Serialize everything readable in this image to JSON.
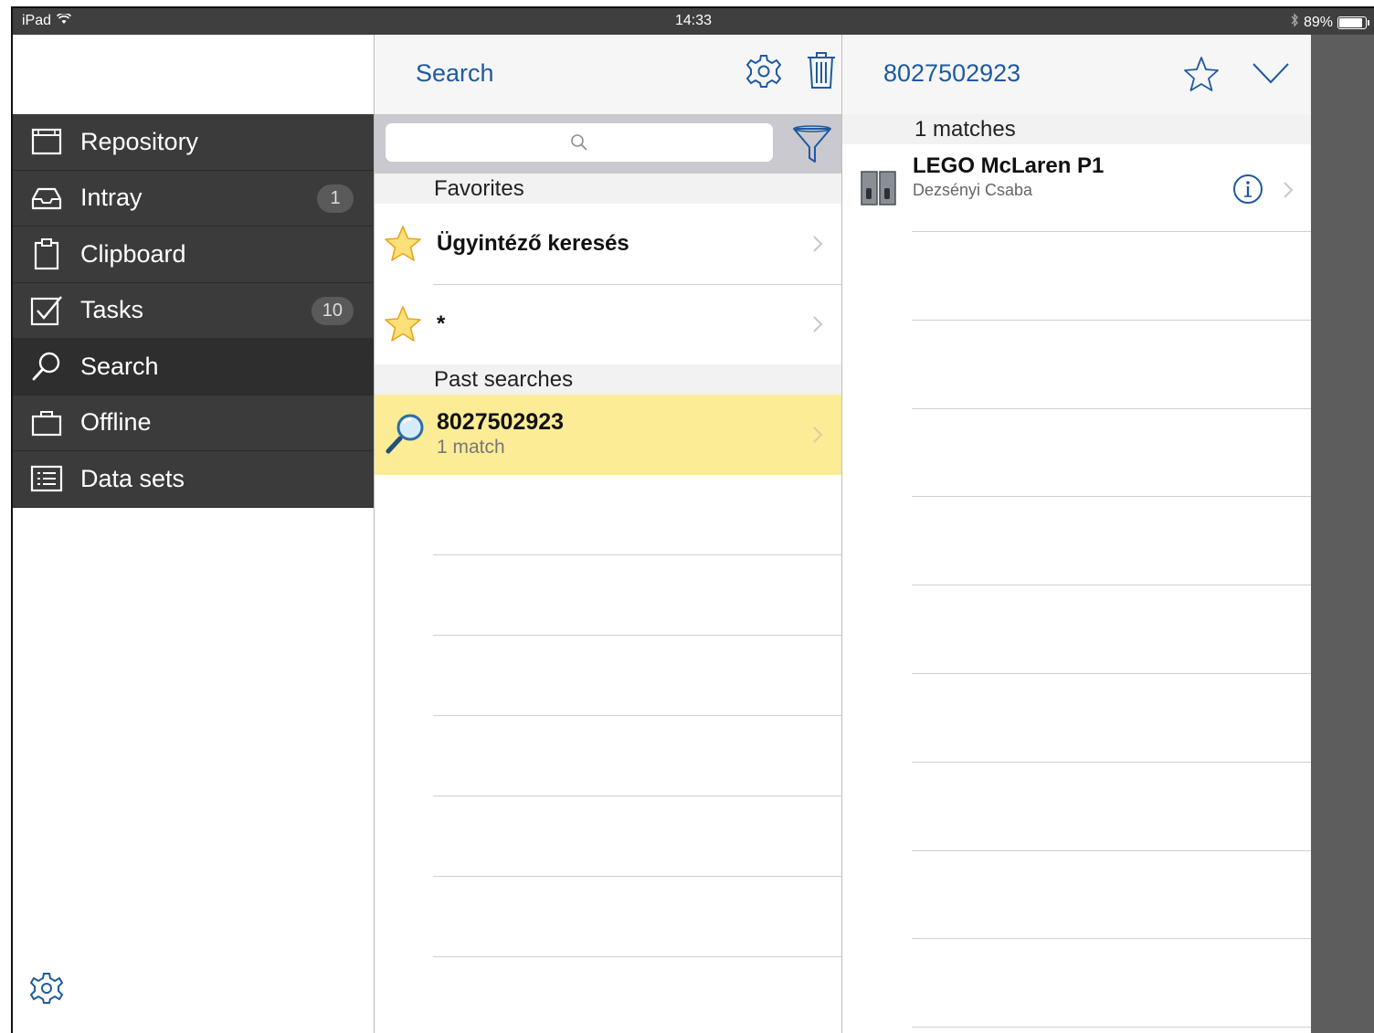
{
  "status_bar": {
    "device": "iPad",
    "time": "14:33",
    "battery_percent": "89%",
    "battery_level": 0.89
  },
  "sidebar": {
    "items": [
      {
        "label": "Repository",
        "icon": "window-icon",
        "badge": ""
      },
      {
        "label": "Intray",
        "icon": "inbox-tray-icon",
        "badge": "1"
      },
      {
        "label": "Clipboard",
        "icon": "clipboard-icon",
        "badge": ""
      },
      {
        "label": "Tasks",
        "icon": "checkbox-icon",
        "badge": "10"
      },
      {
        "label": "Search",
        "icon": "search-icon",
        "badge": ""
      },
      {
        "label": "Offline",
        "icon": "briefcase-icon",
        "badge": ""
      },
      {
        "label": "Data sets",
        "icon": "list-icon",
        "badge": ""
      }
    ],
    "active_item": "Search"
  },
  "search_panel": {
    "title": "Search",
    "search_placeholder": "",
    "favorites_header": "Favorites",
    "favorites": [
      {
        "label": "Ügyintéző keresés"
      },
      {
        "label": "*"
      }
    ],
    "past_header": "Past searches",
    "past_searches": [
      {
        "label": "8027502923",
        "sub": "1 match"
      }
    ]
  },
  "results_panel": {
    "title": "8027502923",
    "matches_label": "1 matches",
    "results": [
      {
        "title": "LEGO McLaren P1",
        "subtitle": "Dezsényi Csaba"
      }
    ]
  },
  "colors": {
    "accent": "#1f5aa0",
    "sidebar_bg": "#3b3b3b",
    "highlight_row": "#fdec96"
  }
}
